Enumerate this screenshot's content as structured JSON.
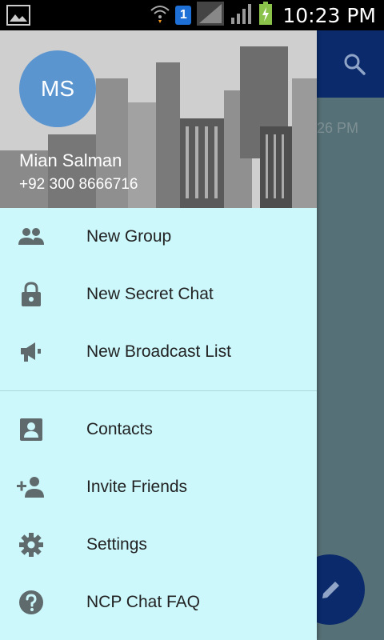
{
  "status_bar": {
    "time": "10:23 PM",
    "sim_badge": "1"
  },
  "background_app": {
    "time_fragment": "26 PM"
  },
  "drawer": {
    "user": {
      "initials": "MS",
      "name": "Mian Salman",
      "phone": "+92 300 8666716"
    },
    "menu_group_1": [
      {
        "label": "New Group",
        "icon": "group-icon"
      },
      {
        "label": "New Secret Chat",
        "icon": "lock-icon"
      },
      {
        "label": "New Broadcast List",
        "icon": "megaphone-icon"
      }
    ],
    "menu_group_2": [
      {
        "label": "Contacts",
        "icon": "contacts-icon"
      },
      {
        "label": "Invite Friends",
        "icon": "add-person-icon"
      },
      {
        "label": "Settings",
        "icon": "gear-icon"
      },
      {
        "label": "NCP Chat FAQ",
        "icon": "help-icon"
      }
    ]
  },
  "colors": {
    "drawer_bg": "#ccf8fc",
    "avatar_bg": "#5b95d0",
    "app_bar": "#0b2a6b",
    "icon": "#5f6a6c"
  }
}
